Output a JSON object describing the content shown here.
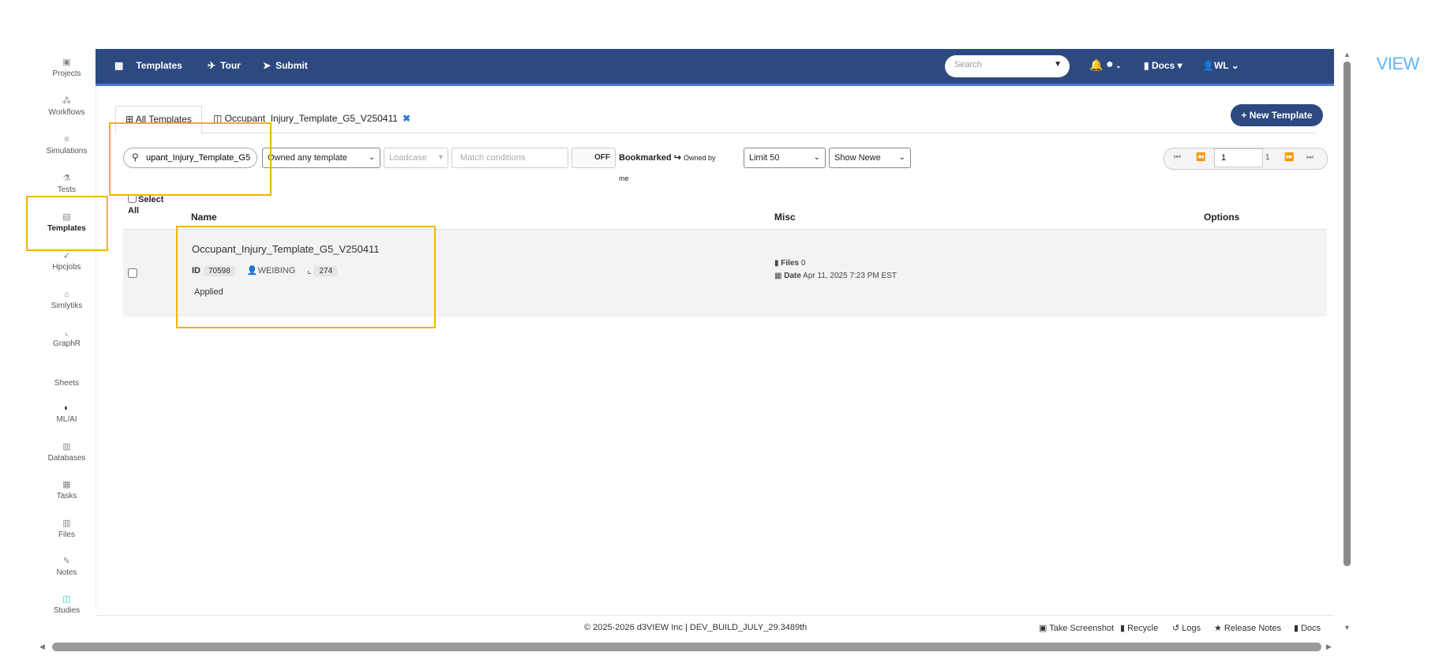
{
  "sidebar": {
    "items": [
      {
        "label": "Projects",
        "icon": "projects-icon",
        "glyph": "▣"
      },
      {
        "label": "Workflows",
        "icon": "workflows-icon",
        "glyph": "⁂"
      },
      {
        "label": "Simulations",
        "icon": "atom-icon",
        "glyph": "⚛"
      },
      {
        "label": "Tests",
        "icon": "flask-icon",
        "glyph": "⚗"
      },
      {
        "label": "Templates",
        "icon": "templates-icon",
        "glyph": "▤"
      },
      {
        "label": "Hpcjobs",
        "icon": "rocket-icon",
        "glyph": "➶"
      },
      {
        "label": "Simlytiks",
        "icon": "simlytiks-icon",
        "glyph": "⌂"
      },
      {
        "label": "GraphR",
        "icon": "line-chart-icon",
        "glyph": "⌞"
      },
      {
        "label": "Sheets",
        "icon": "sheets-icon",
        "glyph": ""
      },
      {
        "label": "ML/AI",
        "icon": "brain-icon",
        "glyph": "◐"
      },
      {
        "label": "Databases",
        "icon": "database-icon",
        "glyph": "▥"
      },
      {
        "label": "Tasks",
        "icon": "tasks-icon",
        "glyph": "▦"
      },
      {
        "label": "Files",
        "icon": "files-icon",
        "glyph": "▥"
      },
      {
        "label": "Notes",
        "icon": "notes-icon",
        "glyph": "✎"
      },
      {
        "label": "Studies",
        "icon": "studies-icon",
        "glyph": "◫"
      }
    ]
  },
  "topbar": {
    "templates": "Templates",
    "tour": "Tour",
    "submit": "Submit",
    "search_placeholder": "Search",
    "docs": "Docs",
    "user": "WL",
    "brand_prefix": "d3",
    "brand_suffix": "VIEW"
  },
  "tabs": {
    "all": "All Templates",
    "open": "Occupant_Injury_Template_G5_V250411"
  },
  "new_template": "New Template",
  "filters": {
    "search_value": "upant_Injury_Template_G5",
    "owner": "Owned any template",
    "loadcase": "Loadcase",
    "match_placeholder": "Match conditions",
    "toggle": "OFF",
    "bookmarked": "Bookmarked",
    "owned_by_me": "Owned by me",
    "limit": "Limit 50",
    "sort": "Show Newe"
  },
  "pagination": {
    "page": "1",
    "total": "1"
  },
  "table": {
    "select_label": "Select",
    "all_label": "All",
    "columns": {
      "name": "Name",
      "misc": "Misc",
      "options": "Options"
    },
    "rows": [
      {
        "name": "Occupant_Injury_Template_G5_V250411",
        "id_label": "ID",
        "id": "70598",
        "owner": "WEIBING",
        "count": "274",
        "status": "Applied",
        "files_label": "Files",
        "files": "0",
        "date_label": "Date",
        "date": "Apr 11, 2025 7:23 PM EST"
      }
    ]
  },
  "footer": {
    "copyright": "© 2025-2026 d3VIEW Inc | DEV_BUILD_JULY_29.3489th",
    "screenshot": "Take Screenshot",
    "recycle": "Recycle",
    "logs": "Logs",
    "release_notes": "Release Notes",
    "docs": "Docs"
  },
  "colors": {
    "topbar": "#2c4a80",
    "accent": "#2b7bd6",
    "highlight": "#f4b400"
  }
}
